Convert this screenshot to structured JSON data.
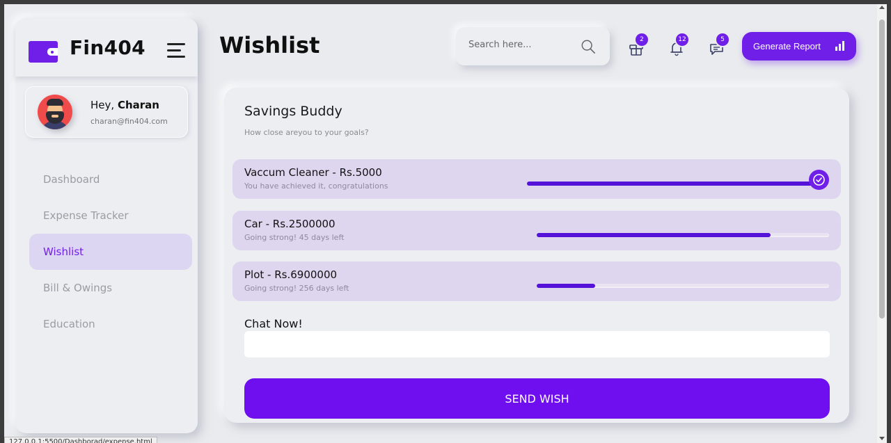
{
  "app": {
    "brand": "Fin404",
    "accent": "#6f1fe7"
  },
  "user": {
    "greeting": "Hey,",
    "name": "Charan",
    "email": "charan@fin404.com"
  },
  "sidebar": {
    "items": [
      {
        "label": "Dashboard",
        "active": false
      },
      {
        "label": "Expense Tracker",
        "active": false
      },
      {
        "label": "Wishlist",
        "active": true
      },
      {
        "label": "Bill & Owings",
        "active": false
      },
      {
        "label": "Education",
        "active": false
      }
    ]
  },
  "header": {
    "title": "Wishlist",
    "search": {
      "placeholder": "Search here...",
      "value": ""
    },
    "gift_badge": "2",
    "bell_badge": "12",
    "chat_badge": "5",
    "report_label": "Generate Report"
  },
  "card": {
    "title": "Savings Buddy",
    "subtitle": "How close areyou to your goals?",
    "goals": [
      {
        "name": "Vaccum Cleaner - Rs.5000",
        "status": "You have achieved it, congratulations",
        "progress": 1.0,
        "completed": true
      },
      {
        "name": "Car - Rs.2500000",
        "status": "Going strong! 45 days left",
        "progress": 0.8,
        "completed": false
      },
      {
        "name": "Plot - Rs.6900000",
        "status": "Going strong! 256 days left",
        "progress": 0.2,
        "completed": false
      }
    ],
    "chat_label": "Chat Now!",
    "chat_value": "",
    "send_label": "SEND WISH"
  },
  "statusbar": {
    "url": "127.0.0.1:5500/Dashborad/expense.html"
  }
}
